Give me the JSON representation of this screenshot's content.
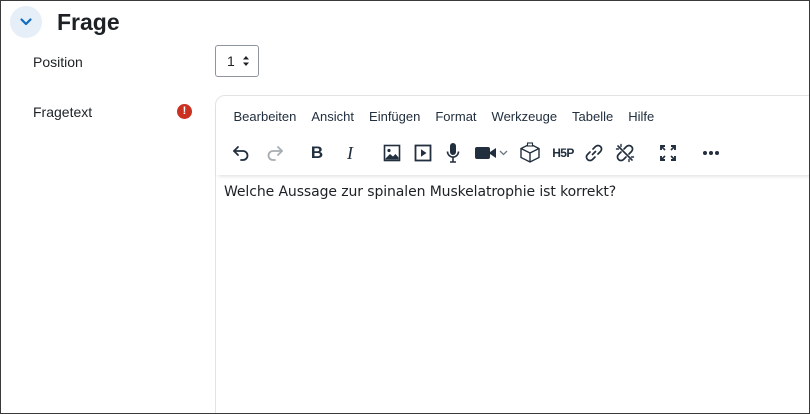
{
  "section": {
    "title": "Frage",
    "collapse_icon": "chevron-down-icon"
  },
  "fields": {
    "position_label": "Position",
    "position_value": "1",
    "fragetext_label": "Fragetext",
    "required_mark": "!"
  },
  "editor": {
    "menu": [
      "Bearbeiten",
      "Ansicht",
      "Einfügen",
      "Format",
      "Werkzeuge",
      "Tabelle",
      "Hilfe"
    ],
    "toolbar_icons": [
      "undo-icon",
      "redo-icon",
      "bold-icon",
      "italic-icon",
      "image-icon",
      "media-icon",
      "microphone-icon",
      "video-camera-icon",
      "3d-cube-icon",
      "h5p-icon",
      "link-icon",
      "unlink-icon",
      "fullscreen-icon",
      "more-icon"
    ],
    "bold_label": "B",
    "italic_label": "I",
    "h5p_label": "H5P",
    "content": "Welche Aussage zur spinalen Muskelatrophie ist korrekt?"
  },
  "colors": {
    "accent": "#0f6cbf",
    "required": "#ca3120",
    "chevron_bg": "#e6eef7"
  }
}
